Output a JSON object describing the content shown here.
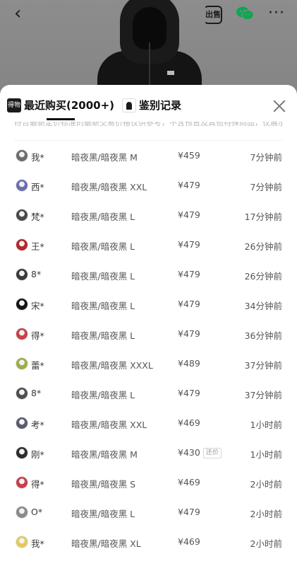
{
  "header": {
    "back_glyph": "‹",
    "sell_label": "出售",
    "more_glyph": "···",
    "icons": [
      "back-icon",
      "sell-icon",
      "wechat-icon",
      "more-icon"
    ],
    "wechat_color": "#07c160"
  },
  "sheet": {
    "tabs": [
      {
        "label": "最近购买(2000+)",
        "icon_text": "得物"
      },
      {
        "label": "鉴别记录"
      }
    ],
    "notice_partial": "符合最新定价标准的最新交易价格仅供参考，不含预售及其他特殊商品，仅展示部分记录"
  },
  "purchases": [
    {
      "name": "我*",
      "spec": "暗夜黑/暗夜黑 M",
      "price": "¥459",
      "time": "7分钟前",
      "avatar_color": "#6d6d6d"
    },
    {
      "name": "西*",
      "spec": "暗夜黑/暗夜黑 XXL",
      "price": "¥479",
      "time": "7分钟前",
      "avatar_color": "#6b6fb0"
    },
    {
      "name": "梵*",
      "spec": "暗夜黑/暗夜黑 L",
      "price": "¥479",
      "time": "17分钟前",
      "avatar_color": "#4a4a4a"
    },
    {
      "name": "王*",
      "spec": "暗夜黑/暗夜黑 L",
      "price": "¥479",
      "time": "26分钟前",
      "avatar_color": "#b5272b"
    },
    {
      "name": "8*",
      "spec": "暗夜黑/暗夜黑 L",
      "price": "¥479",
      "time": "26分钟前",
      "avatar_color": "#3b3b3b"
    },
    {
      "name": "宋*",
      "spec": "暗夜黑/暗夜黑 L",
      "price": "¥479",
      "time": "34分钟前",
      "avatar_color": "#151515"
    },
    {
      "name": "得*",
      "spec": "暗夜黑/暗夜黑 L",
      "price": "¥479",
      "time": "36分钟前",
      "avatar_color": "#c8404a"
    },
    {
      "name": "蕾*",
      "spec": "暗夜黑/暗夜黑 XXXL",
      "price": "¥489",
      "time": "37分钟前",
      "avatar_color": "#9cae4a"
    },
    {
      "name": "8*",
      "spec": "暗夜黑/暗夜黑 L",
      "price": "¥479",
      "time": "37分钟前",
      "avatar_color": "#4f4f4f"
    },
    {
      "name": "考*",
      "spec": "暗夜黑/暗夜黑 XXL",
      "price": "¥469",
      "time": "1小时前",
      "avatar_color": "#5a5a72"
    },
    {
      "name": "刚*",
      "spec": "暗夜黑/暗夜黑 M",
      "price": "¥430",
      "badge": "还价",
      "time": "1小时前",
      "avatar_color": "#2e2e2e"
    },
    {
      "name": "得*",
      "spec": "暗夜黑/暗夜黑 S",
      "price": "¥469",
      "time": "2小时前",
      "avatar_color": "#c8404a"
    },
    {
      "name": "O*",
      "spec": "暗夜黑/暗夜黑 L",
      "price": "¥479",
      "time": "2小时前",
      "avatar_color": "#8a8a8a"
    },
    {
      "name": "我*",
      "spec": "暗夜黑/暗夜黑 XL",
      "price": "¥469",
      "time": "2小时前",
      "avatar_color": "#e3c95a"
    }
  ]
}
